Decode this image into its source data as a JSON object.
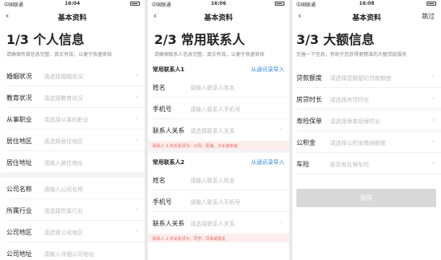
{
  "status": {
    "carrier": "中国联通",
    "battery": "■"
  },
  "screen1": {
    "time": "16:04",
    "nav_title": "基本资料",
    "step_title": "1/3 个人信息",
    "subtitle": "请确保所填信息完整、真实有效，以便于快速审核",
    "personal_rows": [
      {
        "label": "婚姻状况",
        "value": "请选择婚姻状况"
      },
      {
        "label": "教育状况",
        "value": "请选择教育状况"
      },
      {
        "label": "从事职业",
        "value": "请选择从事的职业"
      },
      {
        "label": "居住地区",
        "value": "请选择居住地区"
      },
      {
        "label": "居住地址",
        "value": "请输入居住地址"
      }
    ],
    "company_rows": [
      {
        "label": "公司名称",
        "value": "请输入公司名称"
      },
      {
        "label": "所属行业",
        "value": "请选择所属行业"
      },
      {
        "label": "公司地区",
        "value": "请选择公司地区"
      },
      {
        "label": "公司地址",
        "value": "请输入详细公司地址"
      }
    ]
  },
  "screen2": {
    "time": "16:06",
    "nav_title": "基本资料",
    "step_title": "2/3 常用联系人",
    "subtitle": "请确保联系人信息完整、真实有效，以便于快速审核",
    "contacts": [
      {
        "group_title": "常用联系人1",
        "import_link": "从通讯录导入",
        "rows": [
          {
            "label": "姓名",
            "value": "请输入联系人姓名"
          },
          {
            "label": "手机号",
            "value": "请输入联系人手机号"
          },
          {
            "label": "联系人关系",
            "value": "请选择联系人关系"
          }
        ],
        "hint": "联系人 1 的关系须为：父母、配偶、子女或亲戚"
      },
      {
        "group_title": "常用联系人2",
        "import_link": "从通讯录导入",
        "rows": [
          {
            "label": "姓名",
            "value": "请输入联系人姓名"
          },
          {
            "label": "手机号",
            "value": "请输入联系人手机号"
          },
          {
            "label": "联系人关系",
            "value": "请选择联系人关系"
          }
        ],
        "hint": "联系人 2 的关系须为：同学、同事或朋友"
      }
    ]
  },
  "screen3": {
    "time": "16:08",
    "nav_title": "基本资料",
    "skip_label": "跳过",
    "step_title": "3/3 大额信息",
    "subtitle": "完善一下信息，有助于您获得更精准的大额贷款服务",
    "rows": [
      {
        "label": "贷款额度",
        "value": "请选择您期望的贷款额度"
      },
      {
        "label": "房贷时长",
        "value": "请选择房贷时长"
      },
      {
        "label": "寿险保单",
        "value": "请选择保单投保时长"
      },
      {
        "label": "公积金",
        "value": "请选择公积金缴纳额度"
      },
      {
        "label": "车险",
        "value": "是否有在保车险"
      }
    ],
    "save_label": "保存"
  },
  "icons": {
    "back": "chevron-left-icon",
    "chevron": "chevron-right-icon",
    "wifi": "wifi-icon",
    "signal": "signal-icon",
    "battery": "battery-icon"
  },
  "colors": {
    "link": "#3a8ee6",
    "hint_bg": "#fdeeee",
    "hint_text": "#e66a5a",
    "button_disabled": "#d9d9d9"
  }
}
